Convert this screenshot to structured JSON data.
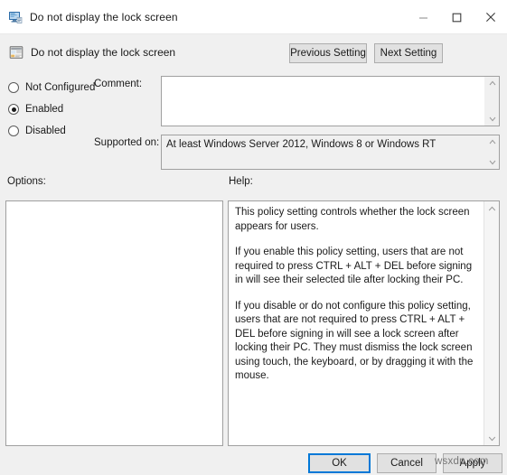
{
  "window": {
    "title": "Do not display the lock screen",
    "icon": "policy-monitor-icon",
    "minimize_label": "Minimize",
    "maximize_label": "Maximize",
    "close_label": "Close"
  },
  "header": {
    "title": "Do not display the lock screen",
    "icon": "policy-setting-icon",
    "previous_setting_label": "Previous Setting",
    "next_setting_label": "Next Setting"
  },
  "state": {
    "options": [
      {
        "id": "not-configured",
        "label": "Not Configured",
        "selected": false
      },
      {
        "id": "enabled",
        "label": "Enabled",
        "selected": true
      },
      {
        "id": "disabled",
        "label": "Disabled",
        "selected": false
      }
    ]
  },
  "fields": {
    "comment_label": "Comment:",
    "comment_value": "",
    "supported_label": "Supported on:",
    "supported_value": "At least Windows Server 2012, Windows 8 or Windows RT"
  },
  "panels": {
    "options_label": "Options:",
    "options_content": "",
    "help_label": "Help:",
    "help_paragraphs": [
      "This policy setting controls whether the lock screen appears for users.",
      "If you enable this policy setting, users that are not required to press CTRL + ALT + DEL before signing in will see their selected tile after locking their PC.",
      "If you disable or do not configure this policy setting, users that are not required to press CTRL + ALT + DEL before signing in will see a lock screen after locking their PC. They must dismiss the lock screen using touch, the keyboard, or by dragging it with the mouse."
    ]
  },
  "footer": {
    "ok_label": "OK",
    "cancel_label": "Cancel",
    "apply_label": "Apply"
  },
  "watermark": {
    "text": "wsxdn.com"
  },
  "colors": {
    "accent": "#0078d7",
    "window_bg": "#f0f0f0",
    "panel_bg": "#ffffff",
    "border": "#a0a0a0",
    "text": "#1a1a1a"
  }
}
